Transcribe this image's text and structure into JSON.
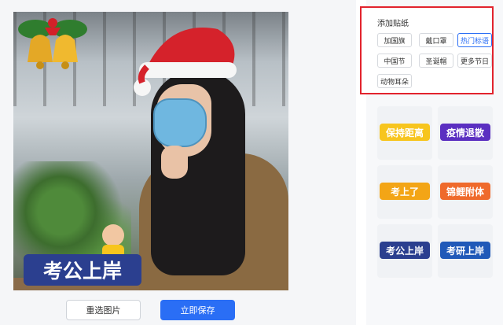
{
  "editor": {
    "reselect_label": "重选图片",
    "save_label": "立即保存"
  },
  "photo_stickers": {
    "text_sticker": "考公上岸"
  },
  "sticker_panel": {
    "title": "添加贴纸",
    "tags": [
      {
        "label": "加国旗",
        "active": false
      },
      {
        "label": "戴口罩",
        "active": false
      },
      {
        "label": "热门标语",
        "active": true
      },
      {
        "label": "中国节",
        "active": false
      },
      {
        "label": "圣诞帽",
        "active": false
      },
      {
        "label": "更多节日",
        "active": false
      },
      {
        "label": "动物耳朵",
        "active": false
      }
    ],
    "stickers": [
      {
        "text": "保持距离",
        "color": "#f7c51e"
      },
      {
        "text": "疫情退散",
        "color": "#5b2fc1"
      },
      {
        "text": "考上了",
        "color": "#f3a516"
      },
      {
        "text": "锦鲤附体",
        "color": "#ef6a2b"
      },
      {
        "text": "考公上岸",
        "color": "#2b3f8f"
      },
      {
        "text": "考研上岸",
        "color": "#2059b8"
      }
    ]
  },
  "colors": {
    "accent": "#2a6ef5",
    "highlight_border": "#e2232d"
  }
}
